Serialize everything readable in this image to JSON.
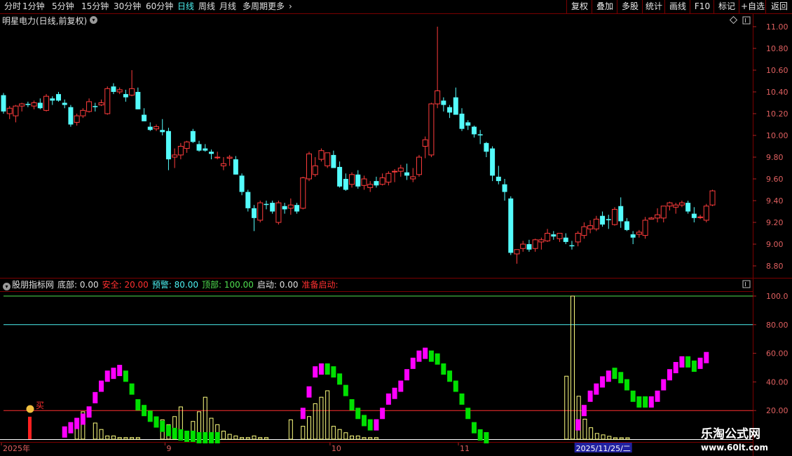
{
  "toolbar": {
    "periods": [
      "分时",
      "1分钟",
      "5分钟",
      "15分钟",
      "30分钟",
      "60分钟",
      "日线",
      "周线",
      "月线",
      "多周期",
      "更多"
    ],
    "active_period": "日线",
    "right_buttons": [
      "复权",
      "叠加",
      "多股",
      "统计",
      "画线",
      "F10",
      "标记",
      "+自选",
      "返回"
    ]
  },
  "chart_title": "明星电力(日线,前复权)",
  "indicator": {
    "name": "股朋指标网",
    "items": [
      {
        "label": "底部: 0.00",
        "color": "#e0e0e0"
      },
      {
        "label": "安全: 20.00",
        "color": "#ff3030"
      },
      {
        "label": "预警: 80.00",
        "color": "#4cf2f2"
      },
      {
        "label": "顶部: 100.00",
        "color": "#50e050"
      },
      {
        "label": "启动: 0.00",
        "color": "#e0e0e0"
      },
      {
        "label": "准备启动:",
        "color": "#ff3030"
      }
    ],
    "buy_label": "买"
  },
  "colors": {
    "up": "#ff3c3c",
    "down": "#54fcfc",
    "grid": "#7a0000",
    "osc_up": "#ff00ff",
    "osc_down": "#00e000",
    "vol": "#ffff80",
    "safe": "#ff3030",
    "warn": "#4cf2f2",
    "top": "#50e050"
  },
  "chart_data": [
    {
      "type": "candlestick",
      "price_axis_ticks": [
        "11.00",
        "10.80",
        "10.60",
        "10.40",
        "10.20",
        "10.00",
        "9.80",
        "9.60",
        "9.40",
        "9.20",
        "9.00",
        "8.80"
      ],
      "ylim": [
        8.75,
        11.05
      ],
      "ohlc": [
        [
          10.37,
          10.39,
          10.2,
          10.22
        ],
        [
          10.2,
          10.27,
          10.15,
          10.25
        ],
        [
          10.18,
          10.28,
          10.12,
          10.27
        ],
        [
          10.27,
          10.3,
          10.22,
          10.29
        ],
        [
          10.29,
          10.31,
          10.26,
          10.28
        ],
        [
          10.27,
          10.32,
          10.24,
          10.3
        ],
        [
          10.3,
          10.34,
          10.24,
          10.25
        ],
        [
          10.23,
          10.38,
          10.22,
          10.36
        ],
        [
          10.34,
          10.36,
          10.28,
          10.32
        ],
        [
          10.38,
          10.4,
          10.31,
          10.32
        ],
        [
          10.3,
          10.33,
          10.25,
          10.28
        ],
        [
          10.26,
          10.28,
          10.08,
          10.1
        ],
        [
          10.12,
          10.2,
          10.09,
          10.18
        ],
        [
          10.18,
          10.25,
          10.16,
          10.23
        ],
        [
          10.22,
          10.34,
          10.21,
          10.31
        ],
        [
          10.27,
          10.3,
          10.22,
          10.26
        ],
        [
          10.28,
          10.33,
          10.27,
          10.3
        ],
        [
          10.2,
          10.45,
          10.19,
          10.43
        ],
        [
          10.45,
          10.48,
          10.38,
          10.4
        ],
        [
          10.4,
          10.44,
          10.38,
          10.42
        ],
        [
          10.38,
          10.42,
          10.31,
          10.35
        ],
        [
          10.37,
          10.6,
          10.36,
          10.43
        ],
        [
          10.4,
          10.44,
          10.24,
          10.24
        ],
        [
          10.19,
          10.25,
          10.13,
          10.13
        ],
        [
          10.08,
          10.12,
          10.04,
          10.05
        ],
        [
          10.06,
          10.1,
          10.04,
          10.08
        ],
        [
          10.05,
          10.15,
          10.0,
          10.03
        ],
        [
          10.04,
          10.07,
          9.68,
          9.78
        ],
        [
          9.8,
          9.88,
          9.7,
          9.82
        ],
        [
          9.82,
          9.93,
          9.78,
          9.9
        ],
        [
          9.88,
          9.95,
          9.84,
          9.94
        ],
        [
          10.04,
          10.06,
          9.93,
          9.94
        ],
        [
          9.92,
          9.95,
          9.85,
          9.86
        ],
        [
          9.88,
          9.92,
          9.85,
          9.86
        ],
        [
          9.85,
          9.87,
          9.78,
          9.83
        ],
        [
          9.8,
          9.85,
          9.78,
          9.8
        ],
        [
          9.72,
          9.8,
          9.68,
          9.74
        ],
        [
          9.79,
          9.82,
          9.72,
          9.8
        ],
        [
          9.78,
          9.81,
          9.64,
          9.64
        ],
        [
          9.63,
          9.65,
          9.45,
          9.48
        ],
        [
          9.48,
          9.5,
          9.3,
          9.33
        ],
        [
          9.33,
          9.36,
          9.12,
          9.24
        ],
        [
          9.22,
          9.4,
          9.2,
          9.38
        ],
        [
          9.37,
          9.4,
          9.32,
          9.36
        ],
        [
          9.38,
          9.4,
          9.28,
          9.3
        ],
        [
          9.2,
          9.4,
          9.18,
          9.38
        ],
        [
          9.35,
          9.38,
          9.28,
          9.32
        ],
        [
          9.33,
          9.42,
          9.27,
          9.36
        ],
        [
          9.36,
          9.38,
          9.28,
          9.3
        ],
        [
          9.33,
          9.62,
          9.32,
          9.61
        ],
        [
          9.6,
          9.85,
          9.58,
          9.83
        ],
        [
          9.64,
          9.8,
          9.62,
          9.72
        ],
        [
          9.78,
          9.88,
          9.76,
          9.86
        ],
        [
          9.72,
          9.84,
          9.7,
          9.84
        ],
        [
          9.82,
          9.86,
          9.71,
          9.7
        ],
        [
          9.71,
          9.76,
          9.52,
          9.53
        ],
        [
          9.6,
          9.65,
          9.49,
          9.5
        ],
        [
          9.55,
          9.66,
          9.52,
          9.64
        ],
        [
          9.64,
          9.68,
          9.51,
          9.53
        ],
        [
          9.54,
          9.63,
          9.5,
          9.6
        ],
        [
          9.52,
          9.58,
          9.48,
          9.55
        ],
        [
          9.58,
          9.62,
          9.52,
          9.54
        ],
        [
          9.55,
          9.65,
          9.54,
          9.61
        ],
        [
          9.57,
          9.67,
          9.54,
          9.65
        ],
        [
          9.67,
          9.69,
          9.57,
          9.67
        ],
        [
          9.67,
          9.73,
          9.62,
          9.7
        ],
        [
          9.66,
          9.74,
          9.59,
          9.63
        ],
        [
          9.6,
          9.7,
          9.57,
          9.62
        ],
        [
          9.64,
          9.82,
          9.62,
          9.8
        ],
        [
          9.9,
          9.99,
          9.79,
          9.96
        ],
        [
          9.82,
          10.3,
          9.8,
          10.29
        ],
        [
          10.29,
          11.0,
          10.25,
          10.41
        ],
        [
          10.32,
          10.35,
          10.22,
          10.28
        ],
        [
          10.26,
          10.28,
          10.16,
          10.21
        ],
        [
          10.35,
          10.44,
          10.19,
          10.19
        ],
        [
          10.2,
          10.25,
          10.04,
          10.06
        ],
        [
          10.12,
          10.14,
          10.05,
          10.09
        ],
        [
          10.08,
          10.09,
          9.98,
          10.01
        ],
        [
          10.01,
          10.05,
          9.92,
          10.0
        ],
        [
          9.93,
          9.94,
          9.8,
          9.85
        ],
        [
          9.88,
          9.9,
          9.58,
          9.63
        ],
        [
          9.62,
          9.72,
          9.55,
          9.58
        ],
        [
          9.55,
          9.6,
          9.4,
          9.48
        ],
        [
          9.42,
          9.44,
          8.9,
          8.92
        ],
        [
          8.91,
          8.95,
          8.82,
          8.95
        ],
        [
          8.96,
          9.03,
          8.93,
          9.0
        ],
        [
          9.0,
          9.04,
          8.93,
          8.95
        ],
        [
          8.96,
          9.05,
          8.93,
          9.04
        ],
        [
          9.02,
          9.06,
          8.95,
          9.04
        ],
        [
          9.03,
          9.14,
          9.02,
          9.1
        ],
        [
          9.09,
          9.12,
          9.04,
          9.07
        ],
        [
          9.05,
          9.1,
          9.02,
          9.1
        ],
        [
          9.06,
          9.1,
          9.0,
          9.02
        ],
        [
          8.99,
          9.03,
          8.95,
          8.98
        ],
        [
          9.02,
          9.12,
          8.98,
          9.1
        ],
        [
          9.08,
          9.2,
          9.05,
          9.16
        ],
        [
          9.14,
          9.22,
          9.1,
          9.17
        ],
        [
          9.14,
          9.26,
          9.12,
          9.23
        ],
        [
          9.26,
          9.3,
          9.16,
          9.18
        ],
        [
          9.23,
          9.27,
          9.14,
          9.22
        ],
        [
          9.18,
          9.34,
          9.17,
          9.32
        ],
        [
          9.35,
          9.43,
          9.15,
          9.21
        ],
        [
          9.21,
          9.24,
          9.12,
          9.13
        ],
        [
          9.09,
          9.12,
          9.0,
          9.06
        ],
        [
          9.09,
          9.13,
          9.06,
          9.11
        ],
        [
          9.08,
          9.25,
          9.05,
          9.22
        ],
        [
          9.23,
          9.25,
          9.23,
          9.24
        ],
        [
          9.24,
          9.33,
          9.2,
          9.27
        ],
        [
          9.24,
          9.35,
          9.2,
          9.35
        ],
        [
          9.35,
          9.39,
          9.31,
          9.38
        ],
        [
          9.34,
          9.38,
          9.28,
          9.36
        ],
        [
          9.36,
          9.4,
          9.34,
          9.38
        ],
        [
          9.38,
          9.4,
          9.28,
          9.3
        ],
        [
          9.28,
          9.34,
          9.2,
          9.24
        ],
        [
          9.25,
          9.27,
          9.23,
          9.25
        ],
        [
          9.22,
          9.37,
          9.2,
          9.35
        ],
        [
          9.36,
          9.5,
          9.35,
          9.49
        ]
      ]
    },
    {
      "type": "bar",
      "osc_axis_ticks": [
        "100.0",
        "80.00",
        "60.00",
        "40.00",
        "20.00"
      ],
      "ylim": [
        0,
        100
      ],
      "levels": [
        20,
        80,
        100
      ],
      "oscillator": [
        0,
        0,
        0,
        0,
        0,
        0,
        0,
        0,
        0,
        0,
        5,
        8,
        11,
        14,
        19,
        29,
        37,
        44,
        46,
        48,
        44,
        35,
        24,
        20,
        16,
        12,
        9,
        6,
        4,
        3,
        2,
        2,
        1,
        1,
        1,
        1,
        0,
        0,
        0,
        0,
        0,
        0,
        0,
        0,
        0,
        0,
        0,
        0,
        0,
        18,
        33,
        47,
        49,
        49,
        47,
        42,
        34,
        24,
        18,
        13,
        10,
        10,
        18,
        28,
        32,
        37,
        45,
        53,
        58,
        60,
        58,
        56,
        49,
        44,
        37,
        28,
        18,
        8,
        3,
        1,
        0,
        0,
        0,
        0,
        0,
        0,
        0,
        0,
        0,
        0,
        0,
        0,
        0,
        0,
        10,
        20,
        30,
        35,
        40,
        44,
        46,
        43,
        38,
        30,
        26,
        26,
        26,
        30,
        38,
        45,
        50,
        54,
        54,
        51,
        53,
        57
      ],
      "oscillator_up": [
        0,
        0,
        0,
        0,
        0,
        0,
        0,
        0,
        0,
        0,
        1,
        1,
        1,
        1,
        1,
        1,
        1,
        1,
        1,
        1,
        0,
        0,
        0,
        0,
        0,
        0,
        0,
        0,
        0,
        0,
        0,
        0,
        0,
        0,
        0,
        0,
        0,
        0,
        0,
        0,
        0,
        0,
        0,
        0,
        0,
        0,
        0,
        0,
        0,
        1,
        1,
        1,
        1,
        0,
        0,
        0,
        0,
        0,
        0,
        0,
        0,
        1,
        1,
        1,
        1,
        1,
        1,
        1,
        1,
        1,
        0,
        0,
        0,
        0,
        0,
        0,
        0,
        0,
        0,
        0,
        0,
        0,
        0,
        0,
        0,
        0,
        0,
        0,
        0,
        0,
        0,
        0,
        0,
        0,
        1,
        1,
        1,
        1,
        1,
        1,
        0,
        0,
        0,
        0,
        0,
        0,
        1,
        1,
        1,
        1,
        1,
        1,
        0,
        0,
        1,
        1
      ],
      "volume_bars": [
        0,
        0,
        0,
        0,
        0,
        0,
        0,
        0,
        0,
        0,
        0,
        0,
        8,
        17,
        0,
        10,
        6,
        2,
        2,
        1,
        1,
        1,
        1,
        0,
        0,
        0,
        12,
        9,
        14,
        20,
        5,
        11,
        17,
        26,
        13,
        9,
        5,
        3,
        2,
        1,
        1,
        2,
        1,
        1,
        0,
        0,
        0,
        12,
        0,
        8,
        14,
        22,
        26,
        30,
        8,
        6,
        4,
        2,
        2,
        1,
        1,
        1,
        0,
        0,
        0,
        0,
        0,
        0,
        0,
        0,
        0,
        0,
        0,
        0,
        0,
        0,
        0,
        0,
        0,
        0,
        0,
        0,
        0,
        0,
        0,
        0,
        0,
        0,
        0,
        0,
        0,
        0,
        0,
        0,
        0,
        0,
        0,
        0,
        0,
        0,
        0,
        0,
        0,
        0,
        0,
        0,
        0,
        0,
        0,
        0,
        0,
        0,
        0,
        0,
        0,
        0,
        0,
        0,
        0,
        0,
        0,
        0,
        0,
        0,
        0,
        0,
        0,
        0,
        0,
        0,
        0,
        0,
        0
      ],
      "volume_bars2": [
        0,
        0,
        0,
        0,
        0,
        0,
        0,
        0,
        0,
        0,
        0,
        0,
        0,
        0,
        0,
        0,
        0,
        0,
        0,
        0,
        0,
        0,
        0,
        0,
        0,
        0,
        0,
        0,
        0,
        0,
        0,
        0,
        0,
        0,
        0,
        0,
        0,
        0,
        0,
        0,
        0,
        0,
        0,
        0,
        0,
        0,
        0,
        0,
        0,
        0,
        0,
        0,
        0,
        0,
        0,
        0,
        0,
        0,
        0,
        0,
        0,
        0,
        0,
        0,
        0,
        0,
        0,
        0,
        0,
        0,
        0,
        0,
        0,
        0,
        0,
        0,
        0,
        0,
        0,
        0,
        0,
        0,
        0,
        0,
        0,
        0,
        0,
        0,
        0,
        0,
        0,
        0,
        44,
        100,
        30,
        14,
        8,
        4,
        3,
        2,
        1,
        1,
        1,
        0,
        0,
        0,
        0,
        0,
        0,
        0,
        0,
        0,
        0,
        0,
        0,
        0,
        0,
        0,
        0,
        0,
        0,
        0,
        0,
        0,
        0
      ],
      "x_labels": [
        {
          "text": "2025年",
          "idx": 0
        },
        {
          "text": "9",
          "idx": 27
        },
        {
          "text": "10",
          "idx": 54
        },
        {
          "text": "11",
          "idx": 75
        },
        {
          "text": "2025/11/25/二",
          "idx": 94
        }
      ]
    }
  ]
}
